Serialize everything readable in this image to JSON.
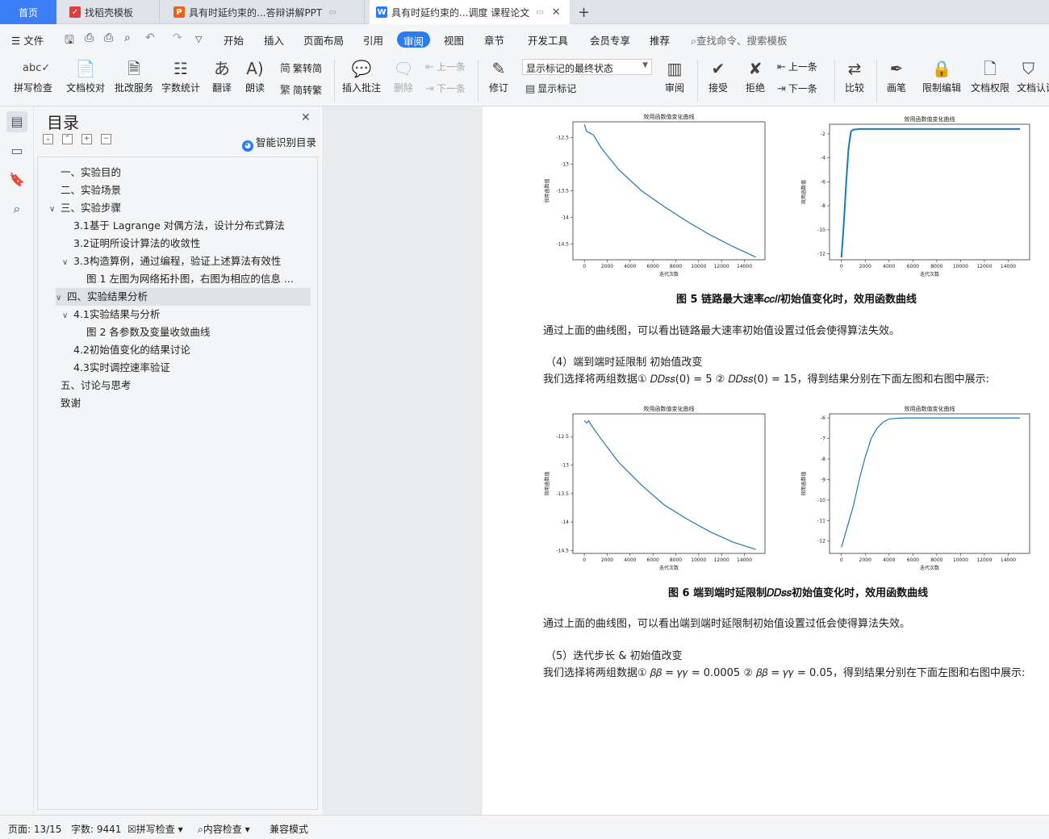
{
  "tabs": {
    "home": "首页",
    "t1": "找稻壳模板",
    "t2": "具有时延约束的...答辩讲解PPT",
    "t3": "具有时延约束的...调度 课程论文",
    "t1_color": "#d94040",
    "t2_color": "#e8641c",
    "t3_color": "#2b7cf2"
  },
  "menu": {
    "file": "文件",
    "items": [
      "开始",
      "插入",
      "页面布局",
      "引用",
      "审阅",
      "视图",
      "章节",
      "开发工具",
      "会员专享",
      "推荐"
    ],
    "active": "审阅",
    "search": "查找命令、搜索模板"
  },
  "ribbon": {
    "spell": "拼写检查",
    "proof": "文档校对",
    "batch": "批改服务",
    "wordcount": "字数统计",
    "translate": "翻译",
    "read": "朗读",
    "trad": "繁转简",
    "simp": "简转繁",
    "insert_comment": "插入批注",
    "delete": "删除",
    "prev_comment": "上一条",
    "next_comment": "下一条",
    "revise": "修订",
    "markup_state": "显示标记的最终状态",
    "show_markup": "显示标记",
    "review": "审阅",
    "accept": "接受",
    "reject": "拒绝",
    "prev": "上一条",
    "next": "下一条",
    "compare": "比较",
    "pen": "画笔",
    "restrict": "限制编辑",
    "permission": "文档权限",
    "auth": "文档认证"
  },
  "toc": {
    "title": "目录",
    "smart": "智能识别目录",
    "items": [
      {
        "label": "一、实验目的",
        "level": 1,
        "caret": ""
      },
      {
        "label": "二、实验场景",
        "level": 1,
        "caret": ""
      },
      {
        "label": "三、实验步骤",
        "level": 1,
        "caret": "v"
      },
      {
        "label": "3.1基于 Lagrange 对偶方法，设计分布式算法",
        "level": 2,
        "caret": ""
      },
      {
        "label": "3.2证明所设计算法的收敛性",
        "level": 2,
        "caret": ""
      },
      {
        "label": "3.3构造算例，通过编程，验证上述算法有效性",
        "level": 2,
        "caret": "v"
      },
      {
        "label": "图 1  左图为网络拓扑图，右图为相应的信息 ...",
        "level": 3,
        "caret": ""
      },
      {
        "label": "四、实验结果分析",
        "level": 1,
        "caret": "v",
        "selected": true
      },
      {
        "label": "4.1实验结果与分析",
        "level": 2,
        "caret": "v"
      },
      {
        "label": "图 2 各参数及变量收敛曲线",
        "level": 3,
        "caret": ""
      },
      {
        "label": "4.2初始值变化的结果讨论",
        "level": 2,
        "caret": ""
      },
      {
        "label": "4.3实时调控速率验证",
        "level": 2,
        "caret": ""
      },
      {
        "label": "五、讨论与思考",
        "level": 1,
        "caret": ""
      },
      {
        "label": "致谢",
        "level": 1,
        "caret": ""
      }
    ]
  },
  "doc": {
    "fig5_caption": "图 5 链路最大速率𝑐𝑐𝑙𝑙初始值变化时，效用函数曲线",
    "p1": "通过上面的曲线图，可以看出链路最大速率初始值设置过低会使得算法失效。",
    "h4": "（4）端到端时延限制          初始值改变",
    "p2": "我们选择将两组数据① 𝐷𝐷𝑠𝑠(0) = 5  ② 𝐷𝐷𝑠𝑠(0) = 15，得到结果分别在下面左图和右图中展示:",
    "fig6_caption": "图 6 端到端时延限制𝐷𝐷𝑠𝑠初始值变化时，效用函数曲线",
    "p3": "通过上面的曲线图，可以看出端到端时延限制初始值设置过低会使得算法失效。",
    "h5": "（5）迭代步长    &    初始值改变",
    "p4": "我们选择将两组数据① 𝛽𝛽 = 𝛾𝛾 = 0.0005 ② 𝛽𝛽 = 𝛾𝛾 = 0.05，得到结果分别在下面左图和右图中展示:"
  },
  "chart_data": [
    {
      "type": "line",
      "title": "效用函数值变化曲线",
      "xlabel": "迭代次数",
      "ylabel": "效用函数值",
      "xlim": [
        -1000,
        15800
      ],
      "ylim": [
        -14.8,
        -12.2
      ],
      "xticks": [
        0,
        2000,
        4000,
        6000,
        8000,
        10000,
        12000,
        14000
      ],
      "yticks": [
        -12.5,
        -13.0,
        -13.5,
        -14.0,
        -14.5
      ],
      "x": [
        0,
        200,
        400,
        800,
        1500,
        3000,
        5000,
        7000,
        9000,
        11000,
        13000,
        15000
      ],
      "y": [
        -12.25,
        -12.38,
        -12.4,
        -12.45,
        -12.7,
        -13.1,
        -13.5,
        -13.8,
        -14.08,
        -14.33,
        -14.55,
        -14.75
      ]
    },
    {
      "type": "line",
      "title": "效用函数值变化曲线",
      "xlabel": "迭代次数",
      "ylabel": "效用函数值",
      "xlim": [
        -1000,
        15800
      ],
      "ylim": [
        -12.5,
        -1.2
      ],
      "xticks": [
        0,
        2000,
        4000,
        6000,
        8000,
        10000,
        12000,
        14000
      ],
      "yticks": [
        -2,
        -4,
        -6,
        -8,
        -10,
        -12
      ],
      "x": [
        0,
        200,
        400,
        600,
        800,
        1000,
        1500,
        3000,
        15000
      ],
      "y": [
        -12.3,
        -9.5,
        -6.0,
        -3.2,
        -1.8,
        -1.65,
        -1.6,
        -1.6,
        -1.6
      ]
    },
    {
      "type": "line",
      "title": "效用函数值变化曲线",
      "xlabel": "迭代次数",
      "ylabel": "效用函数值",
      "xlim": [
        -1000,
        15800
      ],
      "ylim": [
        -14.55,
        -12.1
      ],
      "xticks": [
        0,
        2000,
        4000,
        6000,
        8000,
        10000,
        12000,
        14000
      ],
      "yticks": [
        -12.5,
        -13.0,
        -13.5,
        -14.0,
        -14.5
      ],
      "x": [
        0,
        200,
        400,
        600,
        1500,
        3000,
        5000,
        7000,
        9000,
        11000,
        13000,
        15000
      ],
      "y": [
        -12.22,
        -12.26,
        -12.22,
        -12.3,
        -12.55,
        -12.95,
        -13.35,
        -13.7,
        -13.95,
        -14.17,
        -14.35,
        -14.48
      ]
    },
    {
      "type": "line",
      "title": "效用函数值变化曲线",
      "xlabel": "迭代次数",
      "ylabel": "效用函数值",
      "xlim": [
        -1000,
        15800
      ],
      "ylim": [
        -12.6,
        -5.8
      ],
      "xticks": [
        0,
        2000,
        4000,
        6000,
        8000,
        10000,
        12000,
        14000
      ],
      "yticks": [
        -6,
        -7,
        -8,
        -9,
        -10,
        -11,
        -12
      ],
      "x": [
        0,
        500,
        1000,
        1500,
        2000,
        2500,
        3000,
        3500,
        4000,
        5000,
        7000,
        15000
      ],
      "y": [
        -12.3,
        -11.3,
        -10.3,
        -9.0,
        -7.9,
        -7.0,
        -6.5,
        -6.2,
        -6.05,
        -6.0,
        -6.0,
        -6.0
      ]
    }
  ],
  "status": {
    "page": "页面: 13/15",
    "words": "字数: 9441",
    "spell": "拼写检查",
    "content": "内容检查",
    "compat": "兼容模式"
  }
}
